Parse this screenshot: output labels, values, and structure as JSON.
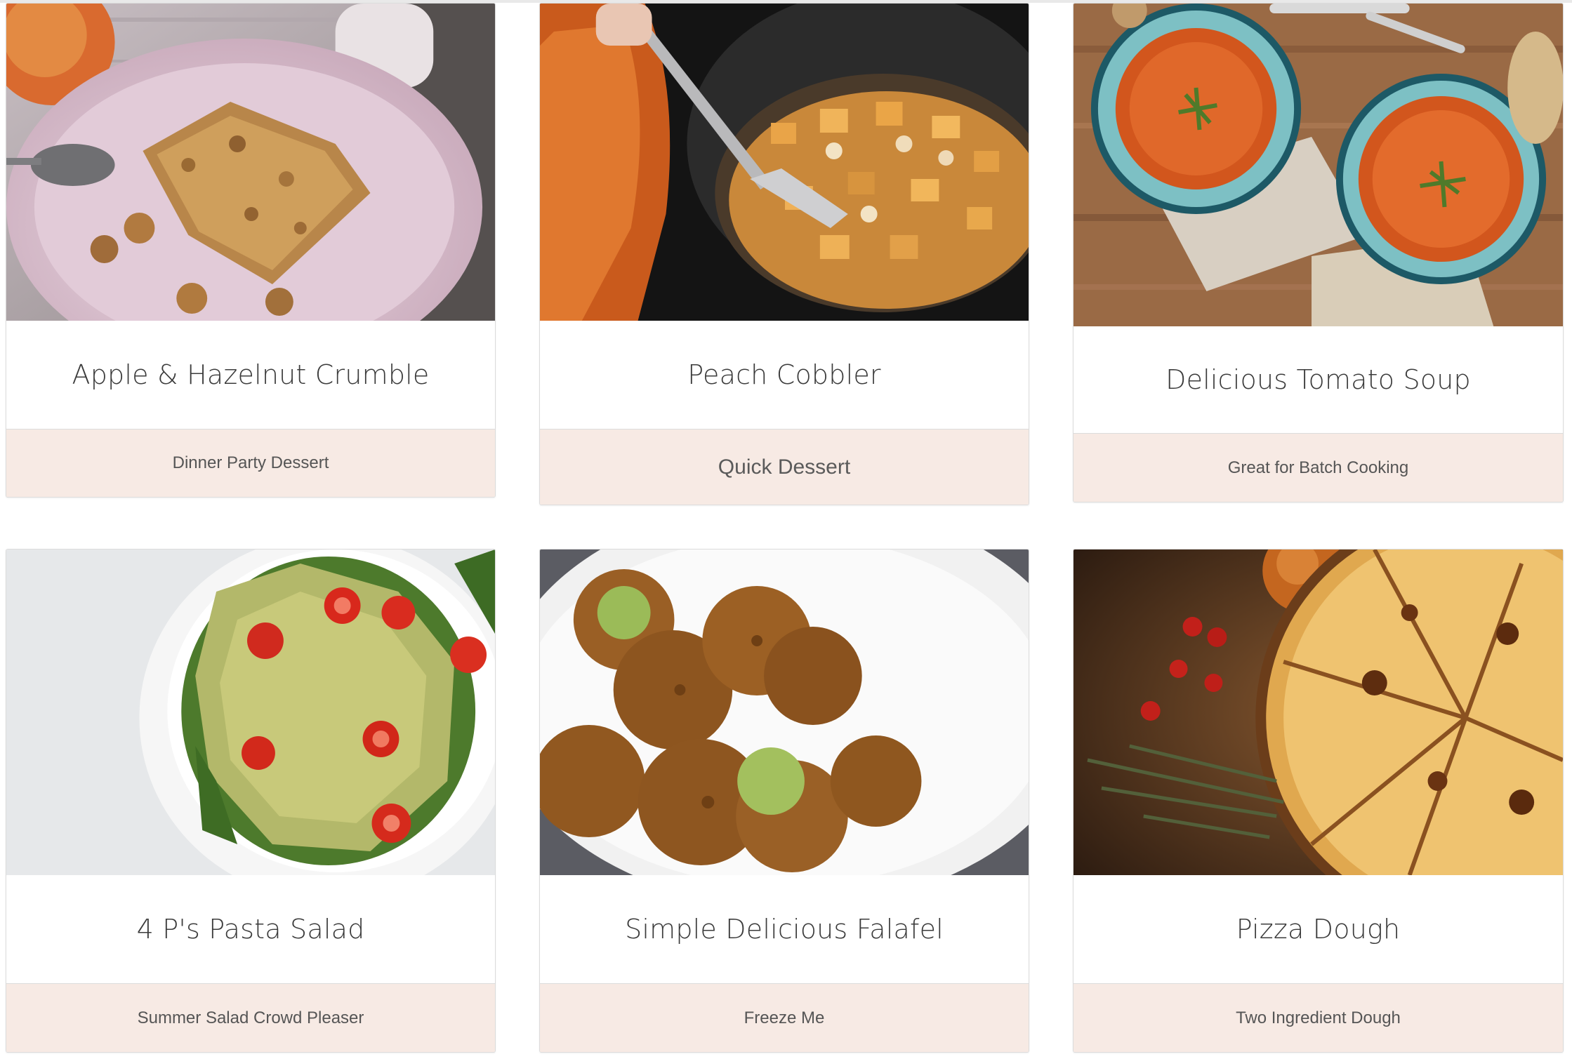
{
  "cards": [
    {
      "title": "Apple & Hazelnut Crumble",
      "tag": "Dinner Party Dessert",
      "image": "apple-hazelnut-crumble-photo"
    },
    {
      "title": "Peach Cobbler",
      "tag": "Quick Dessert",
      "image": "peach-cobbler-photo"
    },
    {
      "title": "Delicious Tomato Soup",
      "tag": "Great for Batch Cooking",
      "image": "tomato-soup-photo"
    },
    {
      "title": "4 P's Pasta Salad",
      "tag": "Summer Salad Crowd Pleaser",
      "image": "pasta-salad-photo"
    },
    {
      "title": "Simple Delicious Falafel",
      "tag": "Freeze Me",
      "image": "falafel-photo"
    },
    {
      "title": "Pizza Dough",
      "tag": "Two Ingredient Dough",
      "image": "pizza-photo"
    }
  ],
  "colors": {
    "footer_background": "#f7eae4",
    "card_border": "#dcdcdc",
    "title_text": "#3b3b3b",
    "footer_text": "#555555"
  }
}
